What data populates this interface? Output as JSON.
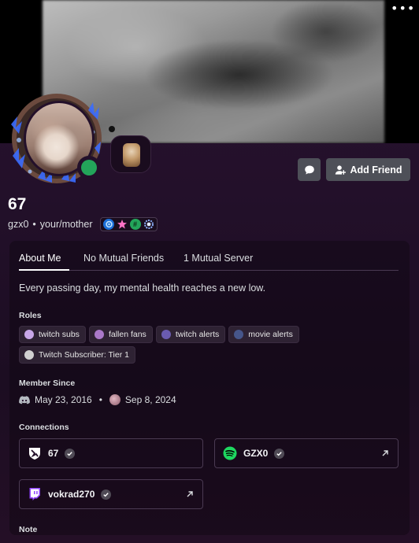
{
  "profile": {
    "display_name": "67",
    "username": "gzx0",
    "separator": "•",
    "pronouns": "your/mother",
    "bio": "Every passing day, my mental health reaches a new low.",
    "online_color": "#23a55a"
  },
  "actions": {
    "more": "•••",
    "add_friend": "Add Friend"
  },
  "tabs": [
    {
      "label": "About Me",
      "active": true
    },
    {
      "label": "No Mutual Friends",
      "active": false
    },
    {
      "label": "1 Mutual Server",
      "active": false
    }
  ],
  "roles": {
    "heading": "Roles",
    "items": [
      {
        "label": "twitch subs",
        "color": "#c8a7e8"
      },
      {
        "label": "fallen fans",
        "color": "#a978c8"
      },
      {
        "label": "twitch alerts",
        "color": "#6a5bb0"
      },
      {
        "label": "movie alerts",
        "color": "#46568a"
      },
      {
        "label": "Twitch Subscriber: Tier 1",
        "color": "#d0d0d0"
      }
    ]
  },
  "member_since": {
    "heading": "Member Since",
    "discord_date": "May 23, 2016",
    "separator": "•",
    "server_date": "Sep 8, 2024"
  },
  "connections": {
    "heading": "Connections",
    "items": [
      {
        "name": "67",
        "service_icon": "shield-logo-icon"
      },
      {
        "name": "GZX0",
        "service_icon": "spotify-icon"
      },
      {
        "name": "vokrad270",
        "service_icon": "twitch-icon"
      }
    ]
  },
  "note": {
    "heading": "Note"
  }
}
